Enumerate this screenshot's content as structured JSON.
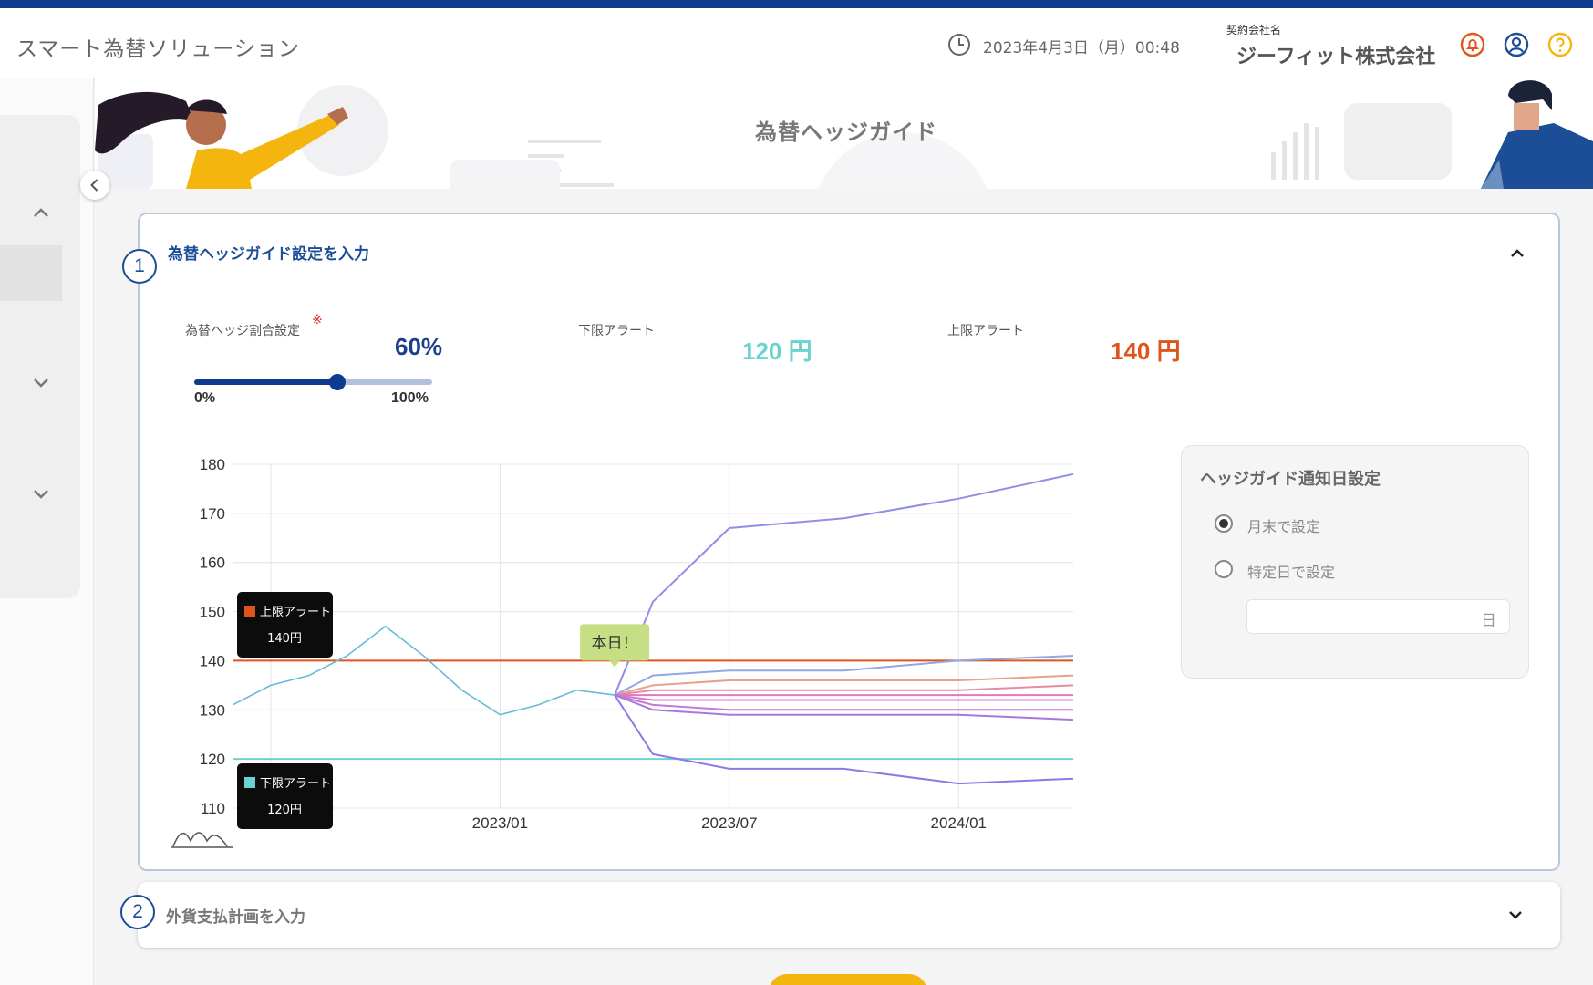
{
  "header": {
    "app_title": "スマート為替ソリューション",
    "datetime": "2023年4月3日（月）00:48",
    "company_label": "契約会社名",
    "company_name": "ジーフィット株式会社"
  },
  "page": {
    "title": "為替ヘッジガイド"
  },
  "colors": {
    "brand": "#0d3b8f",
    "upper_alert": "#e0541c",
    "lower_alert": "#6bd2d0",
    "today_badge": "#c6de84",
    "cta": "#f5b50f"
  },
  "section1": {
    "step": "1",
    "title": "為替ヘッジガイド設定を入力",
    "hedge_ratio_label": "為替ヘッジ割合設定",
    "required_mark": "※",
    "hedge_ratio_value": "60%",
    "hedge_ratio_fraction": 0.6,
    "slider_min": "0%",
    "slider_max": "100%",
    "lower_alert_label": "下限アラート",
    "lower_alert_value": "120 円",
    "upper_alert_label": "上限アラート",
    "upper_alert_value": "140 円"
  },
  "notify": {
    "title": "ヘッジガイド通知日設定",
    "options": [
      "月末で設定",
      "特定日で設定"
    ],
    "selected": 0,
    "day_unit": "日"
  },
  "section2": {
    "step": "2",
    "title": "外貨支払計画を入力"
  },
  "chart_data": {
    "type": "line",
    "ylim": [
      110,
      180
    ],
    "yticks": [
      "180",
      "170",
      "160",
      "150",
      "140",
      "130",
      "120",
      "110"
    ],
    "xticks": [
      {
        "date": "2022/07",
        "label": ""
      },
      {
        "date": "2023/01",
        "label": "2023/01"
      },
      {
        "date": "2023/07",
        "label": "2023/07"
      },
      {
        "date": "2024/01",
        "label": "2024/01"
      }
    ],
    "x_start": "2022/06",
    "x_end": "2024/04",
    "today_x": "2023/04",
    "today_label": "本日！",
    "upper_alert": {
      "value": 140,
      "badge_label": "上限アラート",
      "badge_value": "140円"
    },
    "lower_alert": {
      "value": 120,
      "badge_label": "下限アラート",
      "badge_value": "120円"
    },
    "history": {
      "x": [
        "2022/06",
        "2022/07",
        "2022/08",
        "2022/09",
        "2022/10",
        "2022/11",
        "2022/12",
        "2023/01",
        "2023/02",
        "2023/03",
        "2023/04"
      ],
      "y": [
        131,
        135,
        137,
        141,
        147,
        141,
        134,
        129,
        131,
        134,
        133
      ]
    },
    "forecast": {
      "x": [
        "2023/04",
        "2023/05",
        "2023/07",
        "2023/10",
        "2024/01",
        "2024/04"
      ],
      "series": [
        {
          "color": "#8f8fe6",
          "y": [
            133,
            152,
            167,
            169,
            173,
            178
          ]
        },
        {
          "color": "#8fa8e6",
          "y": [
            133,
            137,
            138,
            138,
            140,
            141
          ]
        },
        {
          "color": "#eaa08a",
          "y": [
            133,
            135,
            136,
            136,
            136,
            137
          ]
        },
        {
          "color": "#e68ca8",
          "y": [
            133,
            134,
            134,
            134,
            134,
            135
          ]
        },
        {
          "color": "#e07ab8",
          "y": [
            133,
            133,
            133,
            133,
            133,
            133
          ]
        },
        {
          "color": "#d27ad6",
          "y": [
            133,
            132,
            132,
            132,
            132,
            132
          ]
        },
        {
          "color": "#c17ad6",
          "y": [
            133,
            131,
            130,
            130,
            130,
            130
          ]
        },
        {
          "color": "#a678de",
          "y": [
            133,
            130,
            129,
            129,
            129,
            128
          ]
        },
        {
          "color": "#8f78e6",
          "y": [
            133,
            121,
            118,
            118,
            115,
            116
          ]
        }
      ]
    }
  }
}
